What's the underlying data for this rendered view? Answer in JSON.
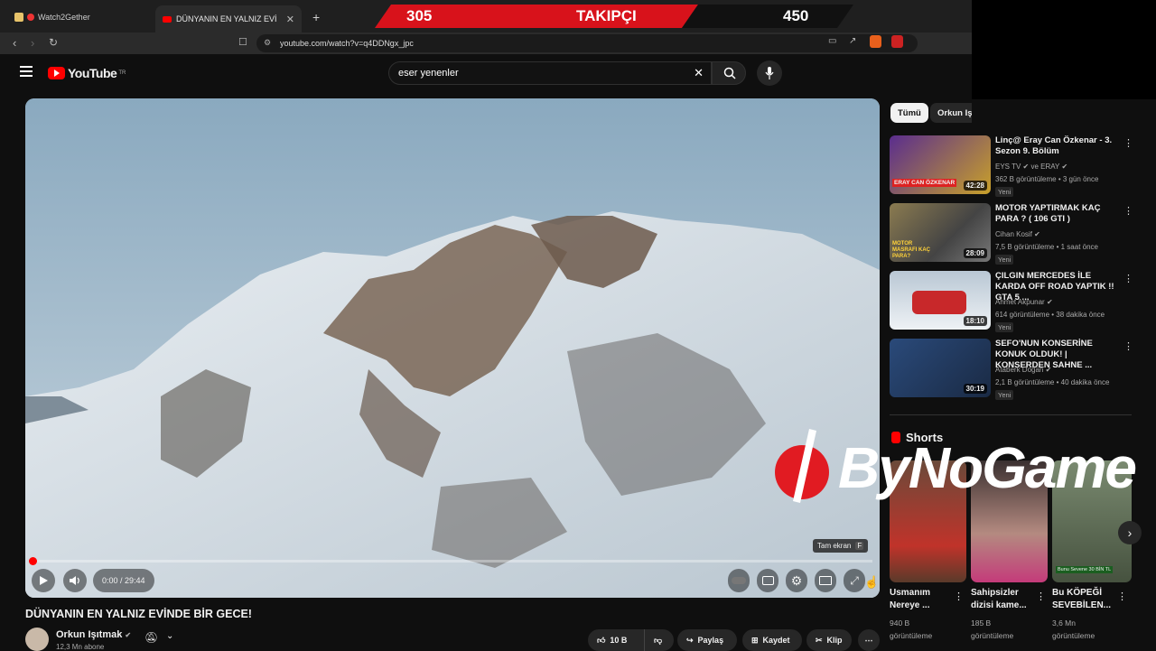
{
  "browser": {
    "tab1": "Watch2Gether",
    "tab2": "DÜNYANIN EN YALNIZ EVİNDE BİR",
    "url": "youtube.com/watch?v=q4DDNgx_jpc"
  },
  "overlay": {
    "left_count": "305",
    "label": "TAKIPÇI",
    "right_count": "450",
    "brand": "ByNoGame"
  },
  "header": {
    "logo": "YouTube",
    "logo_sup": "TR",
    "search_value": "eser yenenler"
  },
  "player": {
    "time": "0:00 / 29:44",
    "tooltip": "Tam ekran",
    "tooltip_key": "F",
    "progress": 0.0
  },
  "video": {
    "title": "DÜNYANIN EN YALNIZ EVİNDE BİR GECE!",
    "channel": "Orkun Işıtmak",
    "subscribers": "12,3 Mn abone",
    "likes": "10 B",
    "share": "Paylaş",
    "save": "Kaydet",
    "clip": "Klip"
  },
  "chips": [
    "Tümü",
    "Orkun Işı"
  ],
  "recommended": [
    {
      "title": "Linç@ Eray Can Özkenar - 3. Sezon 9. Bölüm",
      "channel": "EYS TV",
      "channel2": "ve ERAY",
      "meta": "362 B görüntüleme • 3 gün önce",
      "badge": "Yeni",
      "duration": "42:28",
      "thumb_text": "ERAY CAN ÖZKENAR"
    },
    {
      "title": "MOTOR YAPTIRMAK KAÇ PARA ? ( 106 GTI )",
      "channel": "Cihan Kosif",
      "channel2": "",
      "meta": "7,5 B görüntüleme • 1 saat önce",
      "badge": "Yeni",
      "duration": "28:09",
      "thumb_text": "MOTOR MASRAFI KAÇ PARA?"
    },
    {
      "title": "ÇILGIN MERCEDES İLE KARDA OFF ROAD YAPTIK !! GTA 5 ...",
      "channel": "Ahmet Akpunar",
      "channel2": "",
      "meta": "614 görüntüleme • 38 dakika önce",
      "badge": "Yeni",
      "duration": "18:10",
      "thumb_text": ""
    },
    {
      "title": "SEFO'NUN KONSERİNE KONUK OLDUK! | KONSERDEN SAHNE ...",
      "channel": "Ataberk Doğan",
      "channel2": "",
      "meta": "2,1 B görüntüleme • 40 dakika önce",
      "badge": "Yeni",
      "duration": "30:19",
      "thumb_text": ""
    }
  ],
  "shorts": {
    "heading": "Shorts",
    "items": [
      {
        "title": "Usmanım Nereye ...",
        "views": "940 B",
        "unit": "görüntüleme"
      },
      {
        "title": "Sahipsizler dizisi kame...",
        "views": "185 B",
        "unit": "görüntüleme"
      },
      {
        "title": "Bu KÖPEĞİ SEVEBİLEN...",
        "views": "3,6 Mn",
        "unit": "görüntüleme"
      }
    ],
    "third_overlay": "Bunu Sevene 30 BİN TL"
  },
  "colors": {
    "red": "#d8121b",
    "bg": "#0f0f0f",
    "yt_red": "#ff0000"
  }
}
